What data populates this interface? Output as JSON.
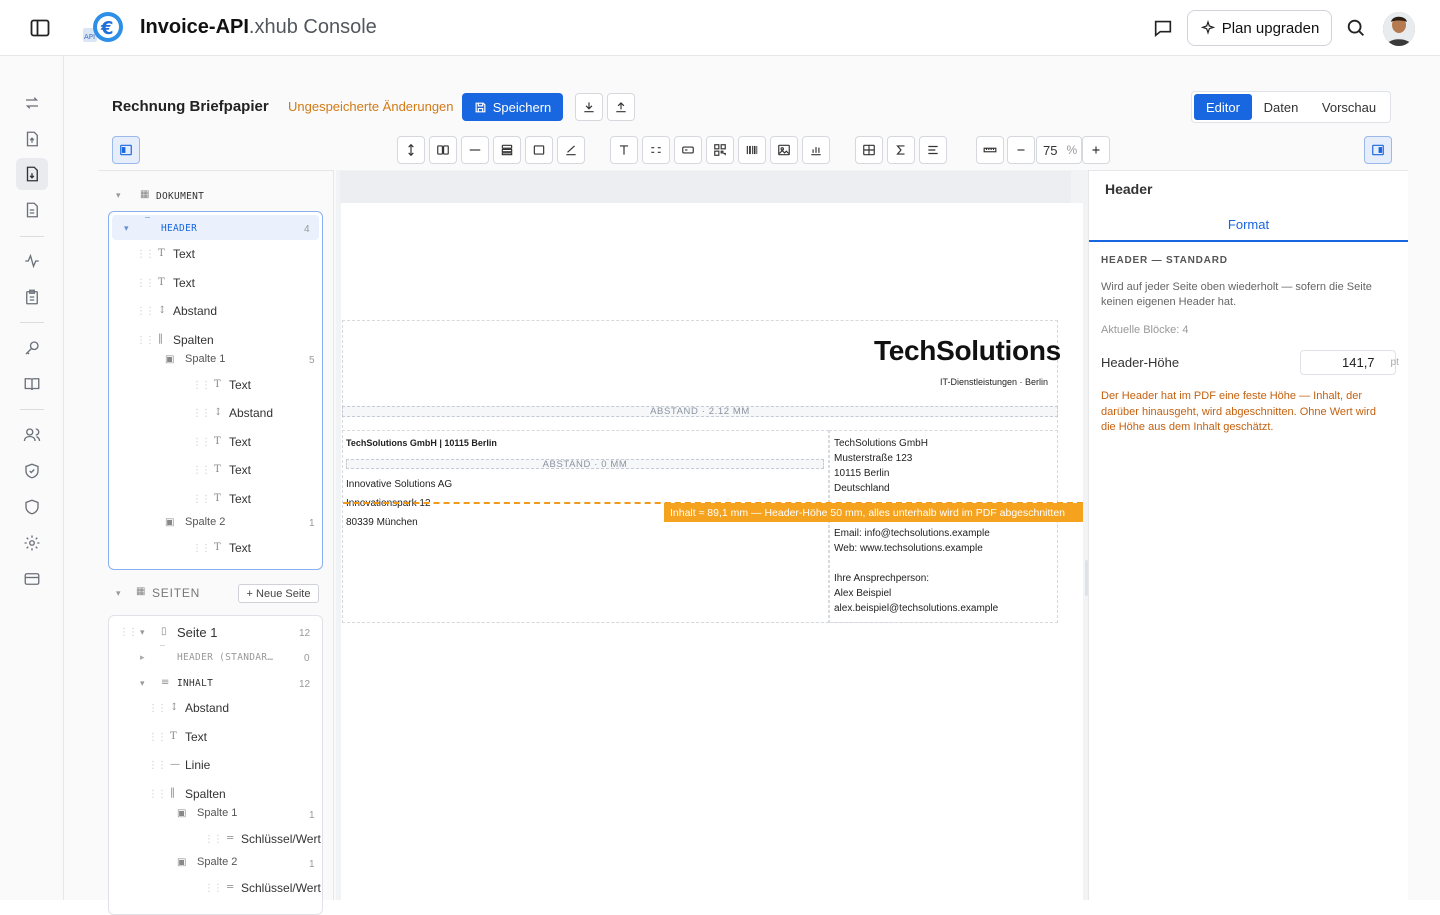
{
  "app": {
    "title_bold": "Invoice-API",
    "title_rest": ".xhub Console",
    "upgrade_label": "Plan upgraden"
  },
  "toolbar": {
    "doc_title": "Rechnung Briefpapier",
    "unsaved": "Ungespeicherte Änderungen",
    "save_label": "Speichern",
    "zoom": "75",
    "zoom_unit": "%"
  },
  "modes": [
    {
      "label": "Editor",
      "active": true
    },
    {
      "label": "Daten",
      "active": false
    },
    {
      "label": "Vorschau",
      "active": false
    }
  ],
  "tree": {
    "root": "DOKUMENT",
    "header": {
      "label": "HEADER",
      "count": "4"
    },
    "header_items": [
      "Text",
      "Text",
      "Abstand",
      "Spalten"
    ],
    "col1": {
      "label": "Spalte 1",
      "count": "5",
      "items": [
        "Text",
        "Abstand",
        "Text",
        "Text",
        "Text"
      ]
    },
    "col2": {
      "label": "Spalte 2",
      "count": "1",
      "items": [
        "Text"
      ]
    },
    "pages_label": "SEITEN",
    "new_page": "+ Neue Seite",
    "page1": {
      "label": "Seite 1",
      "count": "12"
    },
    "page_header": {
      "label": "HEADER (STANDAR…",
      "count": "0"
    },
    "content": {
      "label": "INHALT",
      "count": "12"
    },
    "content_items": [
      "Abstand",
      "Text",
      "Linie",
      "Spalten"
    ],
    "pcol1": {
      "label": "Spalte 1",
      "count": "1",
      "item": "Schlüssel/Wert"
    },
    "pcol2": {
      "label": "Spalte 2",
      "count": "1",
      "item": "Schlüssel/Wert"
    }
  },
  "preview": {
    "company": "TechSolutions",
    "tagline": "IT-Dienstleistungen · Berlin",
    "spacer1": "ABSTAND · 2.12 MM",
    "sender_line": "TechSolutions GmbH | 10115 Berlin",
    "spacer2": "ABSTAND · 0 MM",
    "recipient": [
      "Innovative Solutions AG",
      "Innovationspark 12",
      "80339 München"
    ],
    "right_col": [
      "TechSolutions GmbH",
      "Musterstraße 123",
      "10115 Berlin",
      "Deutschland"
    ],
    "contact": [
      "Email: info@techsolutions.example",
      "Web: www.techsolutions.example"
    ],
    "person": [
      "Ihre Ansprechperson:",
      "Alex Beispiel",
      "alex.beispiel@techsolutions.example"
    ],
    "cut_warning": "Inhalt ≈ 89,1 mm — Header-Höhe 50 mm, alles unterhalb wird im PDF abgeschnitten"
  },
  "inspector": {
    "title": "Header",
    "tab": "Format",
    "section": "HEADER — STANDARD",
    "desc": "Wird auf jeder Seite oben wiederholt — sofern die Seite keinen eigenen Header hat.",
    "blocks": "Aktuelle Blöcke: 4",
    "height_label": "Header-Höhe",
    "height_value": "141,7",
    "height_unit": "pt",
    "warning": "Der Header hat im PDF eine feste Höhe — Inhalt, der darüber hinausgeht, wird abgeschnitten. Ohne Wert wird die Höhe aus dem Inhalt geschätzt."
  },
  "colors": {
    "accent": "#1866e0",
    "warning": "#f5a21e",
    "unsaved": "#d07a16"
  }
}
